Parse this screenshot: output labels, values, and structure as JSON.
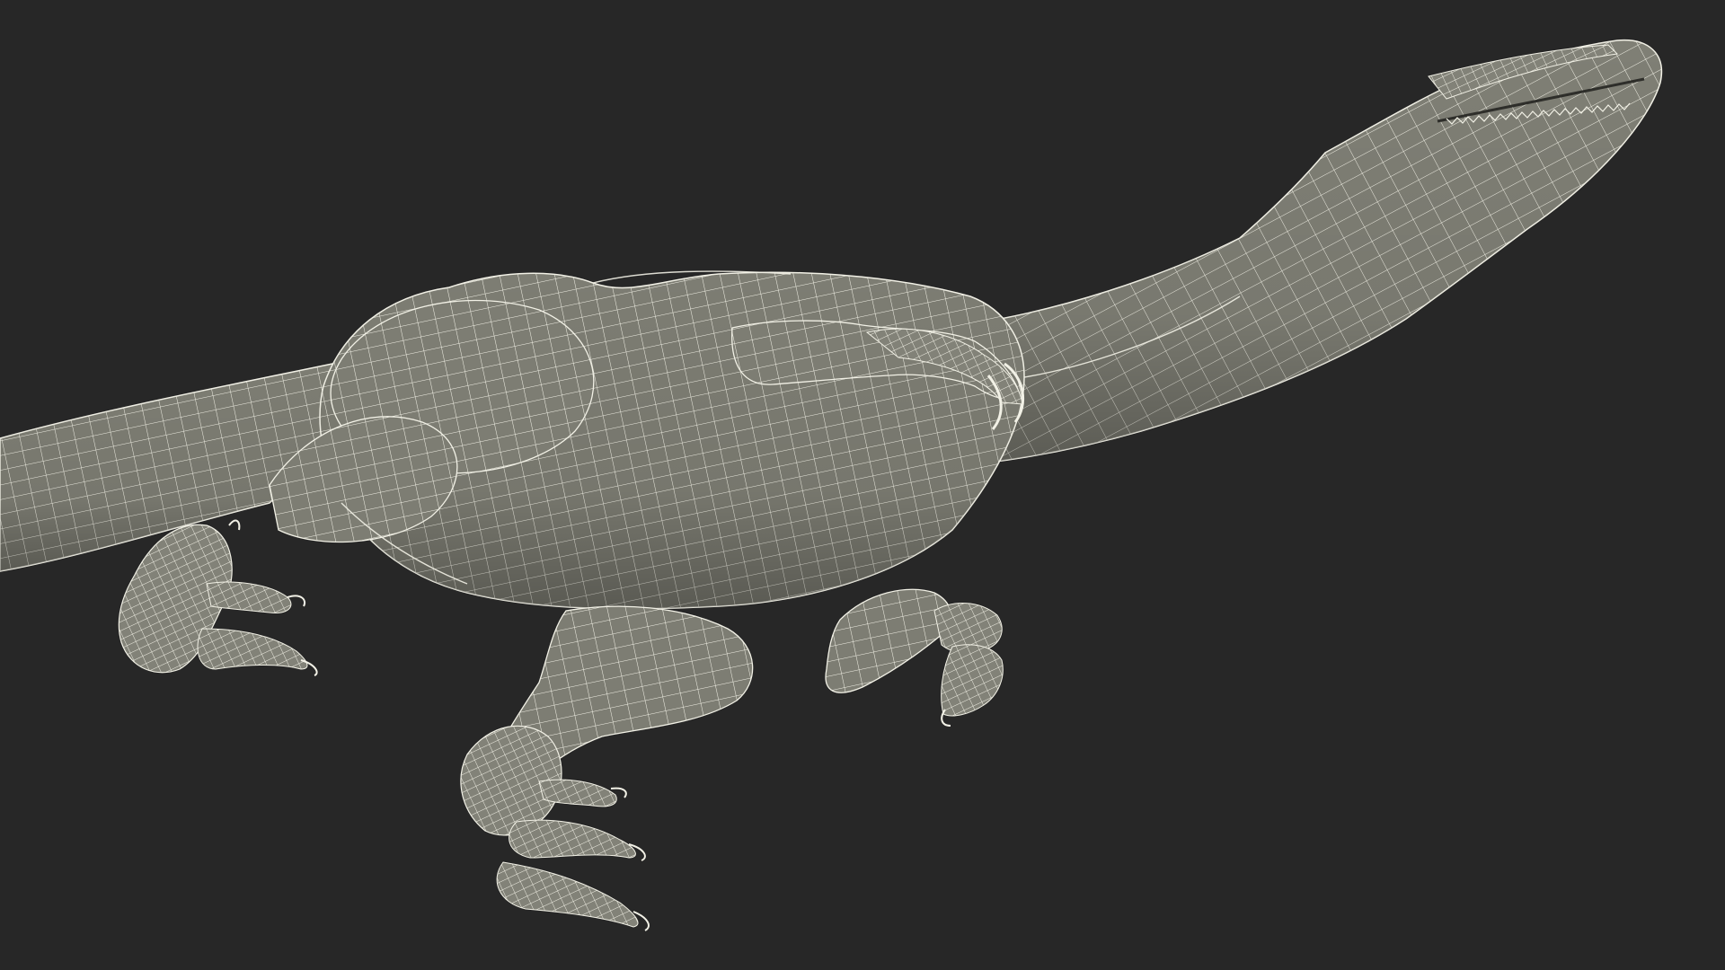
{
  "scene": {
    "subject_icon": "wireframe-dinosaur-model",
    "background_color": "#272727",
    "mesh_fill_color": "#7d7d73",
    "mesh_shadow_color": "#5f5f57",
    "wire_color": "#f2f1e6"
  }
}
